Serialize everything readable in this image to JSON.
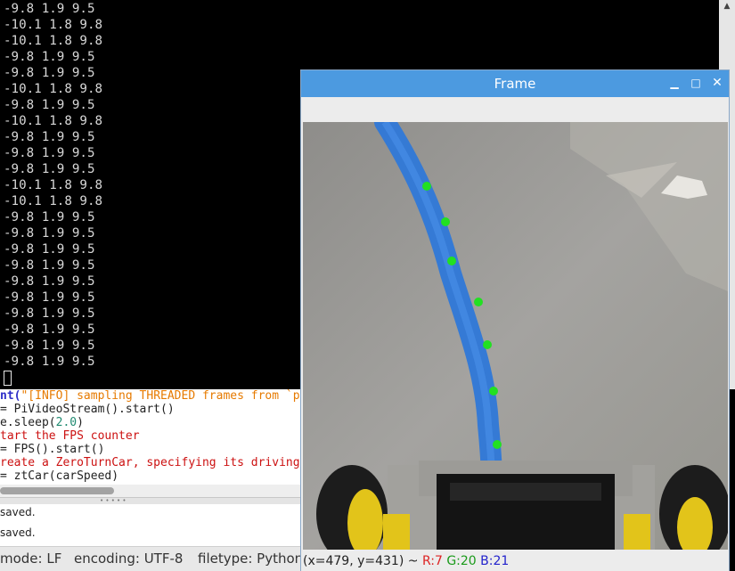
{
  "terminal": {
    "lines": [
      "-9.8 1.9 9.5",
      "-10.1 1.8 9.8",
      "-10.1 1.8 9.8",
      "-9.8 1.9 9.5",
      "-9.8 1.9 9.5",
      "-10.1 1.8 9.8",
      "-9.8 1.9 9.5",
      "-10.1 1.8 9.8",
      "-9.8 1.9 9.5",
      "-9.8 1.9 9.5",
      "-9.8 1.9 9.5",
      "-10.1 1.8 9.8",
      "-10.1 1.8 9.8",
      "-9.8 1.9 9.5",
      "-9.8 1.9 9.5",
      "-9.8 1.9 9.5",
      "-9.8 1.9 9.5",
      "-9.8 1.9 9.5",
      "-9.8 1.9 9.5",
      "-9.8 1.9 9.5",
      "-9.8 1.9 9.5",
      "-9.8 1.9 9.5",
      "-9.8 1.9 9.5"
    ]
  },
  "editor": {
    "code": {
      "l1a": "nt(",
      "l1b": "\"[INFO] sampling THREADED frames from `p",
      "l2a": "= PiVideoStream().start()",
      "l3a": "e.sleep(",
      "l3b": "2.0",
      "l3c": ")",
      "l4a": "tart the FPS counter",
      "l5a": "= FPS().start()",
      "l6a": "reate a ZeroTurnCar, specifying its driving",
      "l7a": "= ztCar(carSpeed)"
    },
    "messages": [
      "saved.",
      "saved."
    ],
    "status": {
      "mode": "mode: LF",
      "encoding": "encoding: UTF-8",
      "filetype": "filetype: Python"
    }
  },
  "frame": {
    "title": "Frame",
    "status": {
      "coords": "(x=479, y=431) ~ ",
      "r": "R:7",
      "g": "G:20",
      "b": "B:21"
    },
    "colors": {
      "tape": "#2f78d8",
      "point": "#22e022",
      "titlebar": "#4c9ae0"
    }
  }
}
